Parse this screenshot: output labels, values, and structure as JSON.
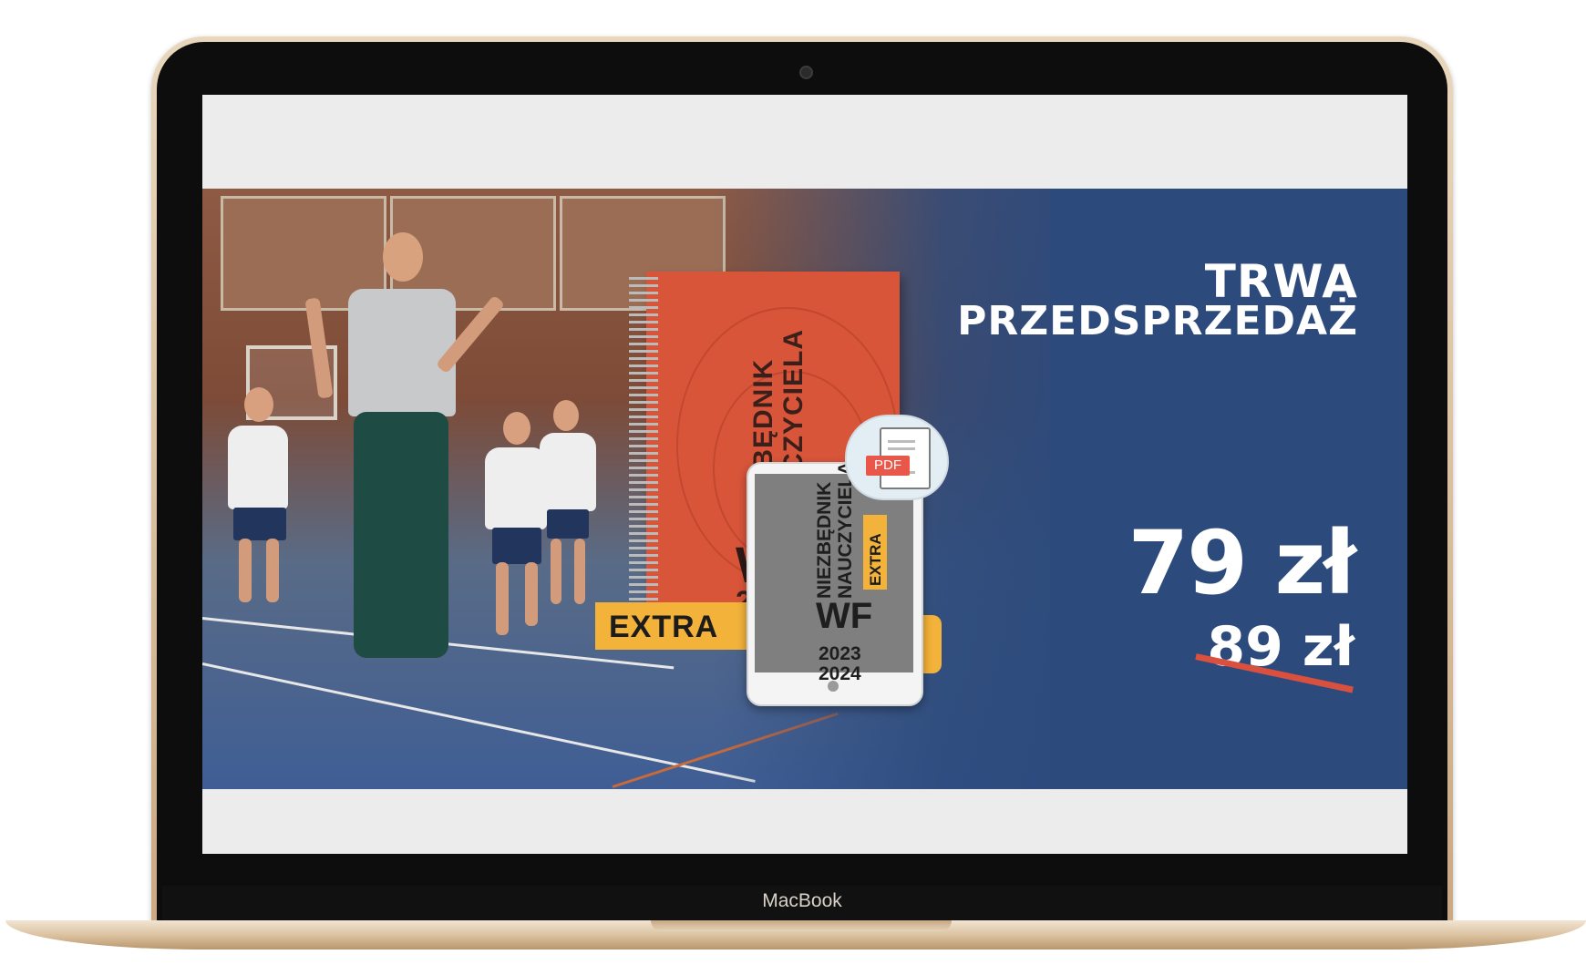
{
  "laptop": {
    "brand_label": "MacBook"
  },
  "banner": {
    "notebook": {
      "title_line1": "NIEZBĘDNIK",
      "title_line2": "NAUCZYCIELA",
      "subject": "WF",
      "year_line1": "2023",
      "year_line2": "2024",
      "tag": "EXTRA"
    },
    "tablet": {
      "title_line1": "NIEZBĘDNIK",
      "title_line2": "NAUCZYCIELA",
      "subject": "WF",
      "year_line1": "2023",
      "year_line2": "2024",
      "tag": "EXTRA",
      "file_badge": "PDF",
      "cloud_icon": "cloud-icon",
      "document_icon": "pdf-document-icon"
    },
    "promo": {
      "line1": "TRWA",
      "line2": "PRZEDSPRZEDAŻ"
    },
    "price": {
      "current": "79 zł",
      "old": "89 zł"
    }
  },
  "colors": {
    "banner_blue": "#2c4a7c",
    "notebook_orange": "#d9553a",
    "tag_yellow": "#f3b239",
    "strike_red": "#d9503f",
    "laptop_gold": "#d8bd98"
  }
}
